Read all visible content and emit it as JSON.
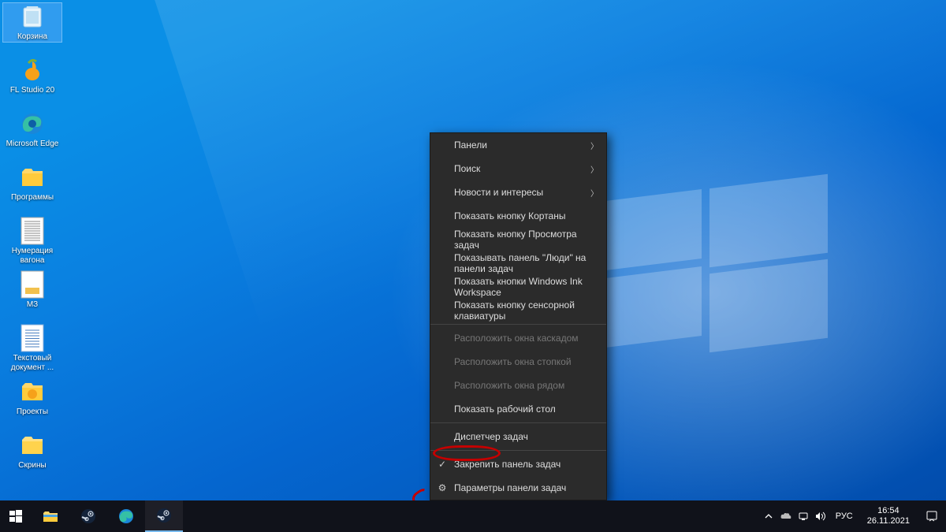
{
  "desktop_icons": [
    {
      "name": "recycle-bin",
      "label": "Корзина",
      "selected": true
    },
    {
      "name": "fl-studio",
      "label": "FL Studio 20"
    },
    {
      "name": "ms-edge",
      "label": "Microsoft Edge"
    },
    {
      "name": "programs",
      "label": "Программы"
    },
    {
      "name": "wagons-doc",
      "label": "Нумерация вагона"
    },
    {
      "name": "mz",
      "label": "МЗ"
    },
    {
      "name": "text-doc",
      "label": "Текстовый документ ..."
    },
    {
      "name": "projects",
      "label": "Проекты"
    },
    {
      "name": "screens",
      "label": "Скрины"
    }
  ],
  "context_menu": {
    "groups": [
      [
        {
          "label": "Панели",
          "submenu": true
        },
        {
          "label": "Поиск",
          "submenu": true
        },
        {
          "label": "Новости и интересы",
          "submenu": true
        },
        {
          "label": "Показать кнопку Кортаны"
        },
        {
          "label": "Показать кнопку Просмотра задач"
        },
        {
          "label": "Показывать панель \"Люди\" на панели задач"
        },
        {
          "label": "Показать кнопки Windows Ink Workspace"
        },
        {
          "label": "Показать кнопку сенсорной клавиатуры"
        }
      ],
      [
        {
          "label": "Расположить окна каскадом",
          "disabled": true
        },
        {
          "label": "Расположить окна стопкой",
          "disabled": true
        },
        {
          "label": "Расположить окна рядом",
          "disabled": true
        },
        {
          "label": "Показать рабочий стол"
        }
      ],
      [
        {
          "label": "Диспетчер задач",
          "highlight": true
        }
      ],
      [
        {
          "label": "Закрепить панель задач",
          "icon": "check"
        },
        {
          "label": "Параметры панели задач",
          "icon": "gear"
        }
      ]
    ]
  },
  "taskbar": {
    "apps": [
      {
        "name": "start",
        "icon": "winstart"
      },
      {
        "name": "file-explorer",
        "icon": "explorer"
      },
      {
        "name": "steam-1",
        "icon": "steam"
      },
      {
        "name": "edge",
        "icon": "edge"
      },
      {
        "name": "steam-2",
        "icon": "steam",
        "active": true
      }
    ]
  },
  "tray": {
    "lang": "РУС",
    "time": "16:54",
    "date": "26.11.2021"
  }
}
